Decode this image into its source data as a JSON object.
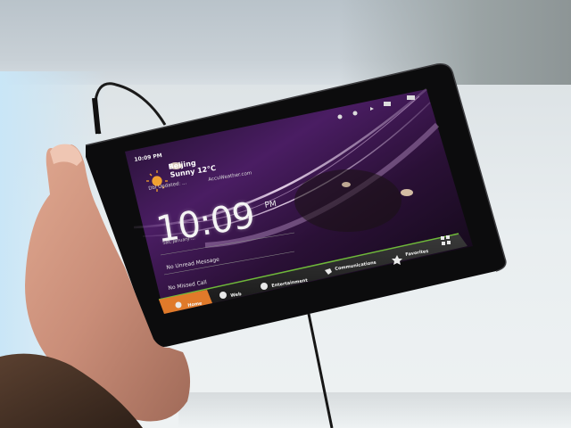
{
  "tablet": {
    "status_time": "10:09 PM",
    "weather": {
      "city": "Beijing",
      "condition": "Sunny 12°C",
      "subline": "Dbl Updated: ...",
      "provider": "AccuWeather.com"
    },
    "clock": {
      "time": "10:09",
      "ampm": "PM",
      "date": "Sat, January ..."
    },
    "notices": [
      "No Unread Message",
      "No Missed Call"
    ],
    "tabs": [
      "Home",
      "Web",
      "Entertainment",
      "Communications",
      "Favorites"
    ]
  },
  "colors": {
    "home_tab": "#e07a2a",
    "accent_line": "#6fb83a",
    "wallpaper": "#3a1a52"
  }
}
